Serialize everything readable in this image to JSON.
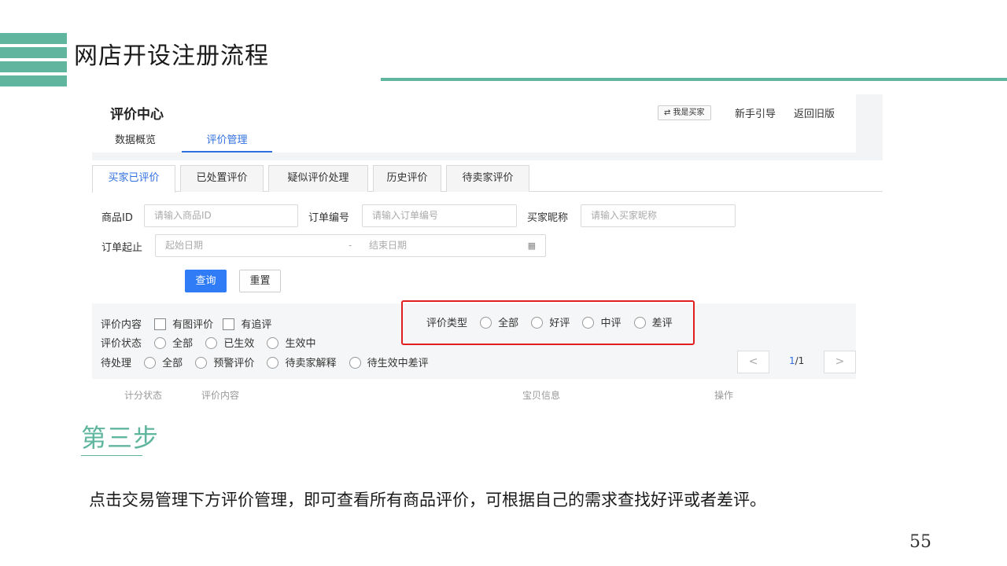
{
  "slide": {
    "title": "网店开设注册流程",
    "step_title": "第三步",
    "description": "点击交易管理下方评价管理，即可查看所有商品评价，可根据自己的需求查找好评或者差评。",
    "page_number": "55",
    "accent_color": "#5fb59e"
  },
  "screenshot": {
    "header": {
      "title": "评价中心",
      "switch_button": "⇄  我是买家",
      "link_guide": "新手引导",
      "link_old": "返回旧版",
      "nav": [
        "数据概览",
        "评价管理"
      ]
    },
    "tabs": [
      "买家已评价",
      "已处置评价",
      "疑似评价处理",
      "历史评价",
      "待卖家评价"
    ],
    "search": {
      "product_id_label": "商品ID",
      "product_id_placeholder": "请输入商品ID",
      "order_no_label": "订单编号",
      "order_no_placeholder": "请输入订单编号",
      "nickname_label": "买家昵称",
      "nickname_placeholder": "请输入买家昵称",
      "date_label": "订单起止",
      "start_placeholder": "起始日期",
      "date_sep": "-",
      "end_placeholder": "结束日期",
      "query_button": "查询",
      "reset_button": "重置"
    },
    "filters": {
      "content_label": "评价内容",
      "content_options": [
        "有图评价",
        "有追评"
      ],
      "type_label": "评价类型",
      "type_options": [
        "全部",
        "好评",
        "中评",
        "差评"
      ],
      "status_label": "评价状态",
      "status_options": [
        "全部",
        "已生效",
        "生效中"
      ],
      "pending_label": "待处理",
      "pending_options": [
        "全部",
        "预警评价",
        "待卖家解释",
        "待生效中差评"
      ]
    },
    "pager": {
      "prev": "<",
      "next": ">",
      "current": "1",
      "total": "/1"
    },
    "table_headers": [
      "计分状态",
      "评价内容",
      "宝贝信息",
      "操作"
    ],
    "highlight_color": "#e02020",
    "primary_color": "#2f7cf6"
  }
}
